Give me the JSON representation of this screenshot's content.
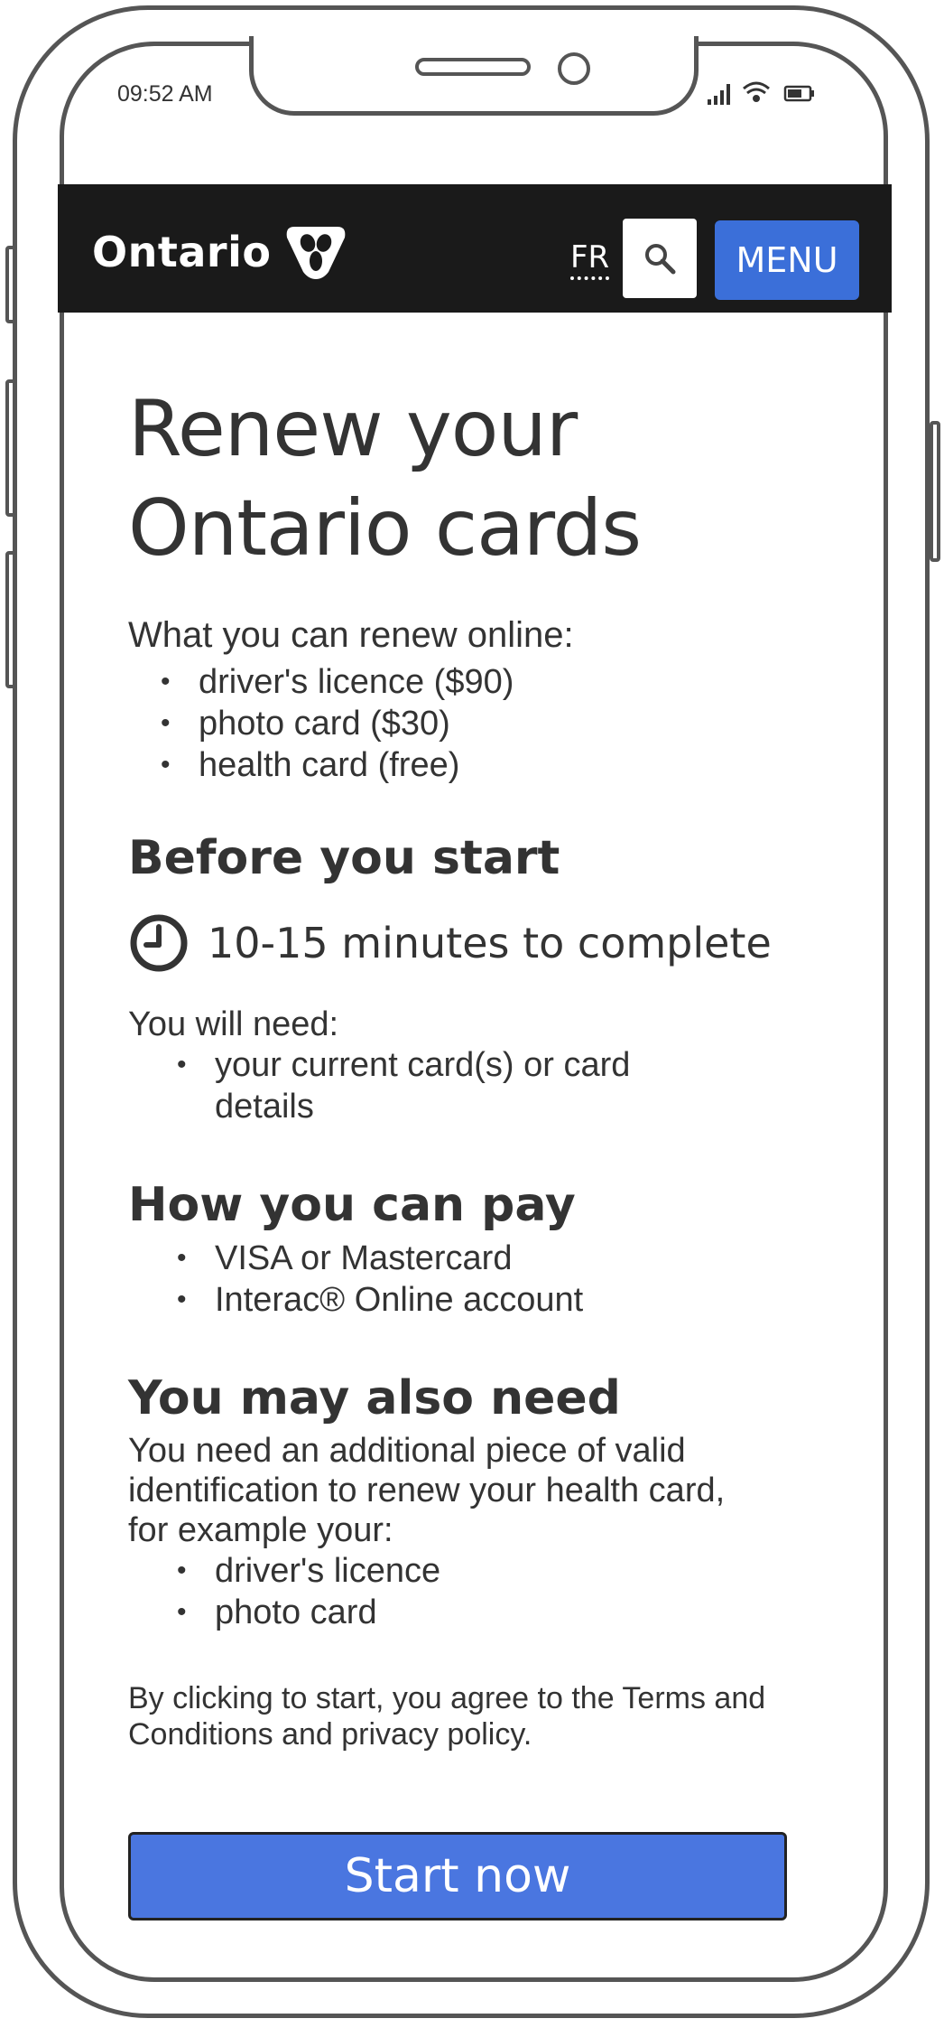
{
  "status_bar": {
    "time": "09:52 AM"
  },
  "header": {
    "logo_text": "Ontario",
    "language_link": "FR",
    "menu_label": "MENU",
    "colors": {
      "bar": "#1a1a1a",
      "accent": "#3b6fd9"
    }
  },
  "main": {
    "title_line1": "Renew your",
    "title_line2": "Ontario cards",
    "intro": "What you can renew online:",
    "renew_items": [
      "driver's licence ($90)",
      "photo card ($30)",
      "health card (free)"
    ],
    "before": {
      "heading": "Before you start",
      "time_text": "10-15 minutes to complete",
      "need_label": "You will need:",
      "need_item_line1": "your current card(s) or card",
      "need_item_line2": "details"
    },
    "pay": {
      "heading": "How you can pay",
      "items": [
        "VISA or Mastercard",
        "Interac® Online account"
      ]
    },
    "also": {
      "heading": "You may also need",
      "line1": "You need an additional piece of valid",
      "line2": "identification to renew your health card,",
      "line3": "for example your:",
      "items": [
        "driver's licence",
        "photo card"
      ]
    },
    "agree_line1": "By clicking to start, you agree to the Terms and",
    "agree_line2": "Conditions and privacy policy.",
    "start_label": "Start now",
    "start_color": "#4a76e0"
  }
}
